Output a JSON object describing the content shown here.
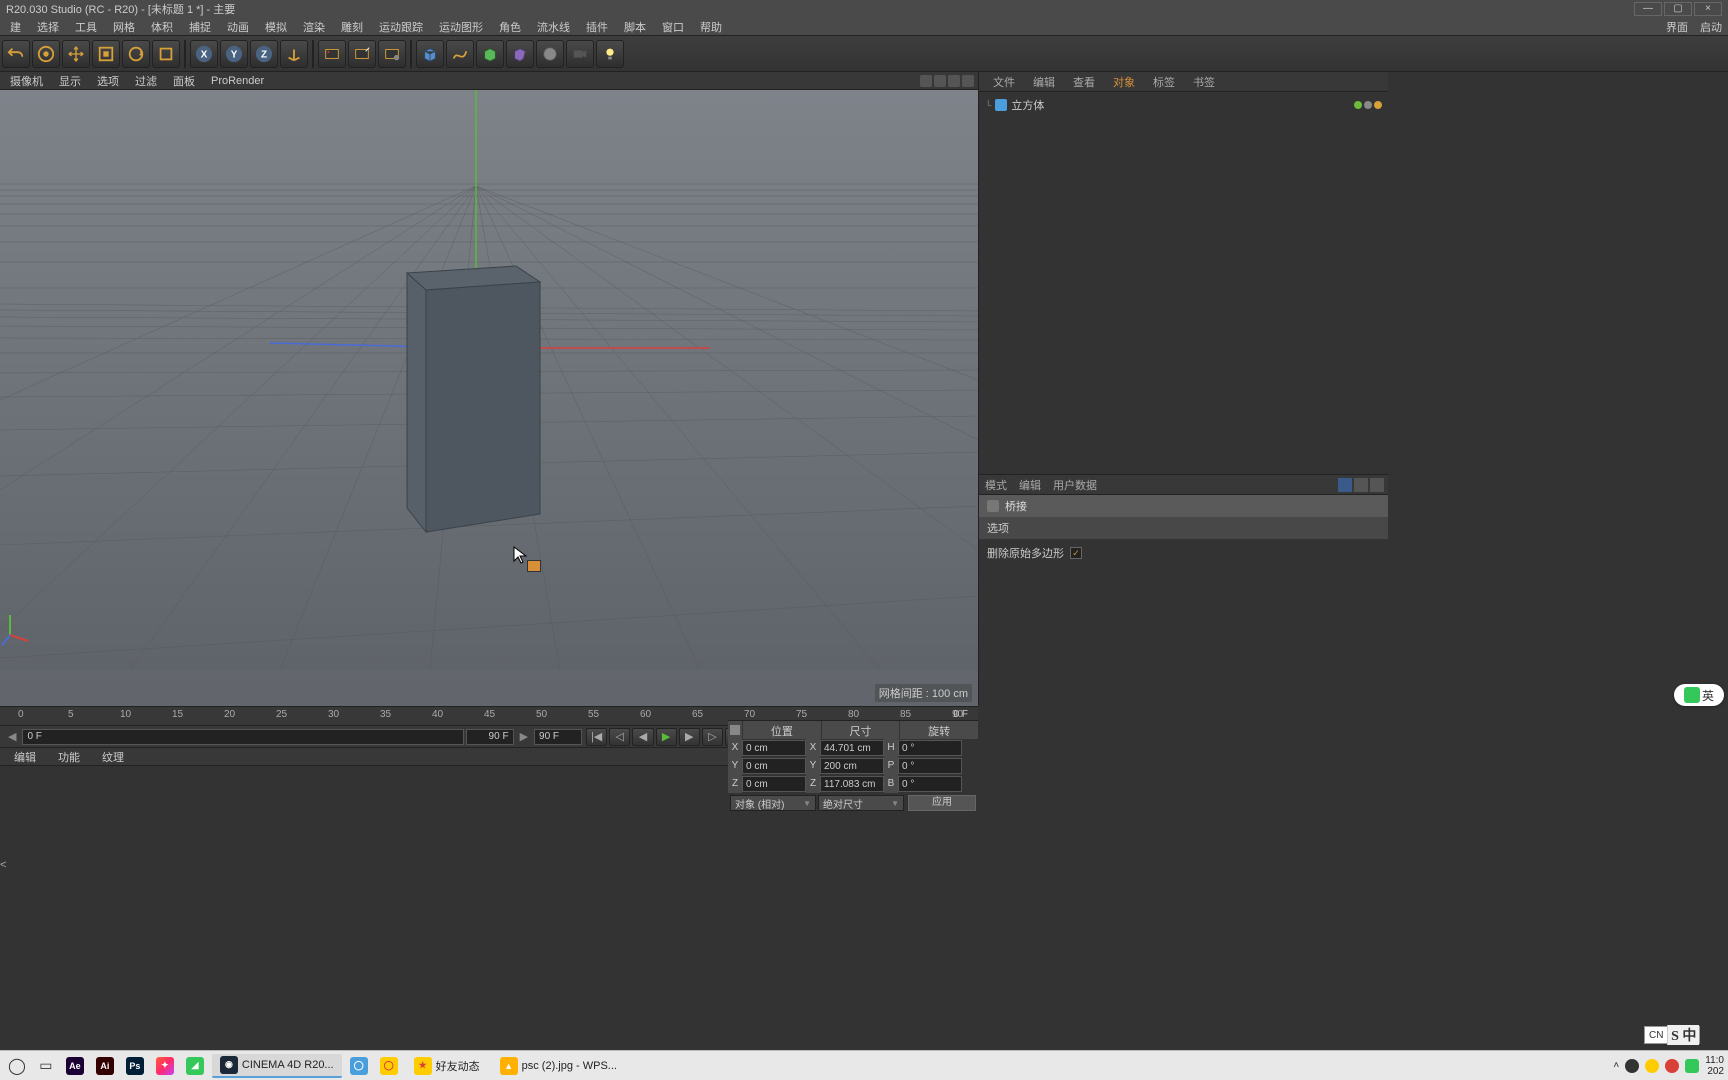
{
  "titlebar": {
    "title": "R20.030 Studio (RC - R20) - [未标题 1 *] - 主要"
  },
  "menubar": {
    "items": [
      "建",
      "选择",
      "工具",
      "网格",
      "体积",
      "捕捉",
      "动画",
      "模拟",
      "渲染",
      "雕刻",
      "运动跟踪",
      "运动图形",
      "角色",
      "流水线",
      "插件",
      "脚本",
      "窗口",
      "帮助"
    ],
    "right": [
      "界面",
      "启动"
    ]
  },
  "viewport_menu": {
    "items": [
      "摄像机",
      "显示",
      "选项",
      "过滤",
      "面板",
      "ProRender"
    ]
  },
  "grid_info": "网格间距 : 100 cm",
  "obj_panel": {
    "tabs": [
      "文件",
      "编辑",
      "查看",
      "对象",
      "标签",
      "书签"
    ],
    "active_tab": "对象",
    "item": {
      "name": "立方体"
    }
  },
  "attr_panel": {
    "tabs": [
      "模式",
      "编辑",
      "用户数据"
    ],
    "title": "桥接",
    "section": "选项",
    "opt": {
      "label": "删除原始多边形",
      "checked": true
    }
  },
  "timeline": {
    "ticks": [
      0,
      5,
      10,
      15,
      20,
      25,
      30,
      35,
      40,
      45,
      50,
      55,
      60,
      65,
      70,
      75,
      80,
      85,
      90
    ],
    "start": "0 F",
    "end": "90 F",
    "frame": "0 F"
  },
  "bottom_tabs": [
    "编辑",
    "功能",
    "纹理"
  ],
  "coords": {
    "headers": [
      "位置",
      "尺寸",
      "旋转"
    ],
    "axes": [
      "X",
      "Y",
      "Z"
    ],
    "secondary": [
      "X",
      "Y",
      "Z"
    ],
    "tertiary": [
      "H",
      "P",
      "B"
    ],
    "pos": [
      "0 cm",
      "0 cm",
      "0 cm"
    ],
    "size": [
      "44.701 cm",
      "200 cm",
      "117.083 cm"
    ],
    "rot": [
      "0 °",
      "0 °",
      "0 °"
    ],
    "rel_mode": "对象 (相对)",
    "abs_mode": "绝对尺寸",
    "apply": "应用"
  },
  "taskbar": {
    "apps": [
      {
        "name": "start",
        "label": "",
        "bg": "transparent",
        "txt": "◯"
      },
      {
        "name": "taskview",
        "label": "",
        "bg": "transparent",
        "txt": "▭"
      },
      {
        "name": "ae",
        "label": "",
        "bg": "#1a0033",
        "txt": "Ae"
      },
      {
        "name": "ai",
        "label": "",
        "bg": "#330000",
        "txt": "Ai"
      },
      {
        "name": "ps",
        "label": "",
        "bg": "#001e36",
        "txt": "Ps"
      },
      {
        "name": "app5",
        "label": "",
        "bg": "#ff9500",
        "txt": "●"
      },
      {
        "name": "app6",
        "label": "",
        "bg": "#34c759",
        "txt": "◢"
      },
      {
        "name": "c4d",
        "label": "CINEMA 4D R20...",
        "bg": "#222",
        "txt": "◉",
        "active": true
      },
      {
        "name": "browser",
        "label": "",
        "bg": "#4a9edb",
        "txt": "◯"
      },
      {
        "name": "app8",
        "label": "",
        "bg": "#ffcc00",
        "txt": "◯"
      },
      {
        "name": "haoyu",
        "label": "好友动态",
        "bg": "#ffcc00",
        "txt": "★"
      },
      {
        "name": "wps",
        "label": "psc (2).jpg - WPS...",
        "bg": "#ffb000",
        "txt": "▲"
      }
    ],
    "clock": {
      "time": "11:0",
      "date": "202"
    }
  },
  "ime": {
    "lang": "CN",
    "mode": "S 中"
  },
  "ime_float": "英"
}
